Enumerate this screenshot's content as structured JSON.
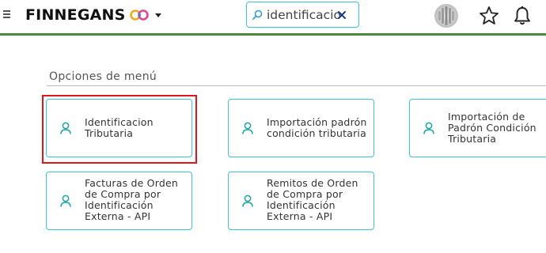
{
  "header": {
    "brand": "FINNEGANS",
    "search_value": "identificacio",
    "accent_color": "#39c7d6",
    "header_line_color": "#4a8a3a"
  },
  "section": {
    "title": "Opciones de menú"
  },
  "cards": [
    {
      "label_lines": [
        "Identificacion",
        "Tributaria"
      ],
      "icon": "person-icon"
    },
    {
      "label_lines": [
        "Importación padrón",
        "condición tributaria"
      ],
      "icon": "person-icon"
    },
    {
      "label_lines": [
        "Importación de",
        "Padrón Condición",
        "Tributaria"
      ],
      "icon": "person-icon"
    },
    {
      "label_lines": [
        "Facturas de Orden",
        "de Compra por",
        "Identificación",
        "Externa - API"
      ],
      "icon": "person-icon"
    },
    {
      "label_lines": [
        "Remitos de Orden",
        "de Compra por",
        "Identificación",
        "Externa - API"
      ],
      "icon": "person-icon"
    }
  ],
  "highlight_color": "#e3161b"
}
